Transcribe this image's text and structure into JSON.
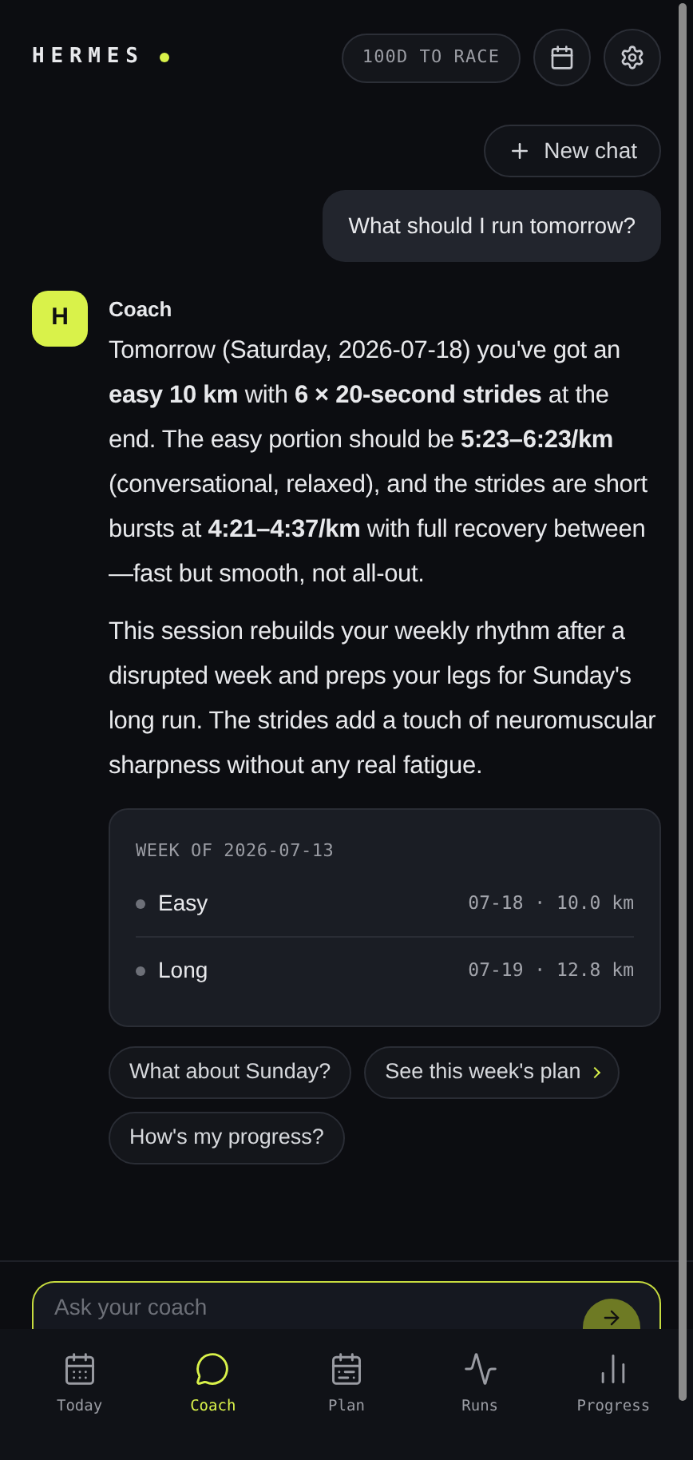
{
  "header": {
    "brand": "HERMES",
    "countdown": "100D TO RACE"
  },
  "new_chat": "New chat",
  "user_message": "What should I run tomorrow?",
  "coach": {
    "avatar": "H",
    "name": "Coach",
    "paragraphs": [
      "Tomorrow (Saturday, 2026-07-18) you've got an **easy 10 km** with **6 × 20-second strides** at the end. The easy portion should be **5:23–6:23/km** (conversational, relaxed), and the strides are short bursts at **4:21–4:37/km** with full recovery between—fast but smooth, not all-out.",
      "This session rebuilds your weekly rhythm after a disrupted week and preps your legs for Sunday's long run. The strides add a touch of neuromuscular sharpness without any real fatigue."
    ],
    "week_card": {
      "title": "WEEK OF 2026-07-13",
      "runs": [
        {
          "type": "Easy",
          "detail": "07-18 · 10.0 km"
        },
        {
          "type": "Long",
          "detail": "07-19 · 12.8 km"
        }
      ]
    },
    "suggestions": [
      {
        "label": "What about Sunday?",
        "kind": "plain"
      },
      {
        "label": "See this week's plan",
        "kind": "link"
      },
      {
        "label": "How's my progress?",
        "kind": "plain"
      }
    ]
  },
  "composer": {
    "placeholder": "Ask your coach"
  },
  "nav": [
    {
      "label": "Today",
      "selected": false,
      "kind": "today"
    },
    {
      "label": "Coach",
      "selected": true,
      "kind": "coach"
    },
    {
      "label": "Plan",
      "selected": false,
      "kind": "plan"
    },
    {
      "label": "Runs",
      "selected": false,
      "kind": "runs"
    },
    {
      "label": "Progress",
      "selected": false,
      "kind": "progress"
    }
  ]
}
